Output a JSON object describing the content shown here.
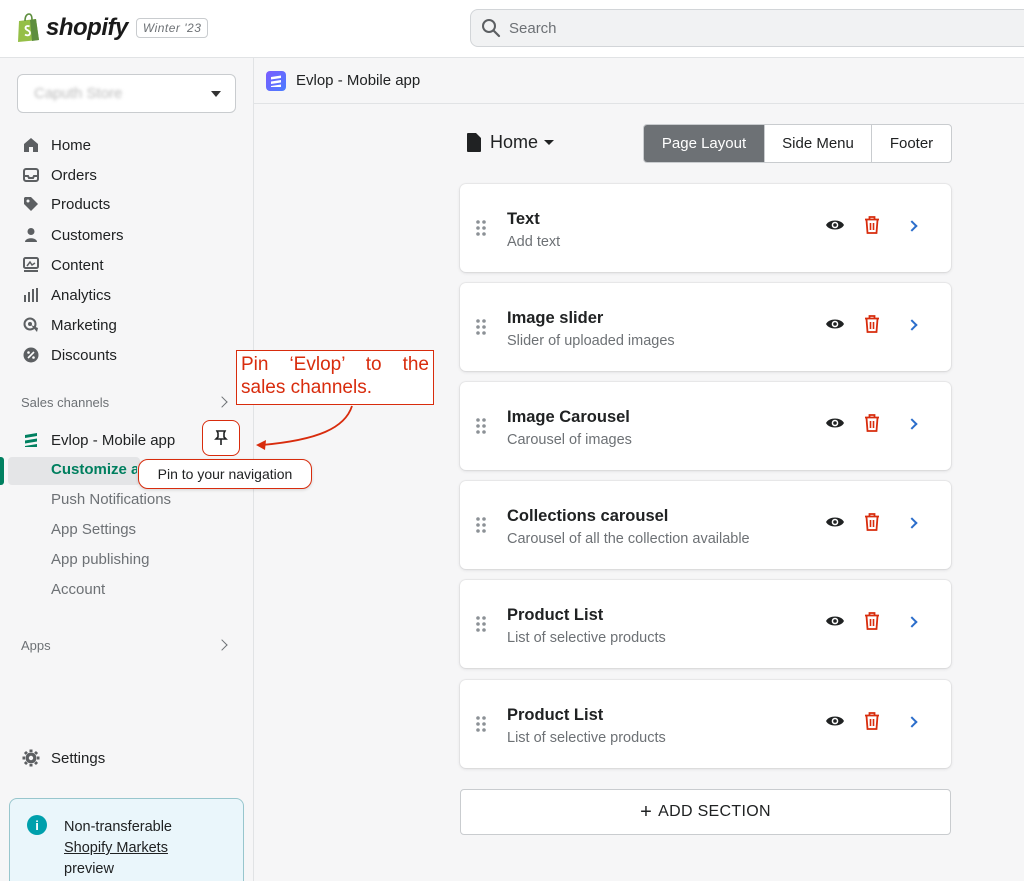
{
  "topbar": {
    "brand": "shopify",
    "version": "Winter '23",
    "search_placeholder": "Search"
  },
  "sidebar": {
    "store_name": "Caputh Store",
    "nav": [
      {
        "label": "Home",
        "icon": "home-icon"
      },
      {
        "label": "Orders",
        "icon": "orders-icon"
      },
      {
        "label": "Products",
        "icon": "tag-icon"
      },
      {
        "label": "Customers",
        "icon": "person-icon"
      },
      {
        "label": "Content",
        "icon": "content-icon"
      },
      {
        "label": "Analytics",
        "icon": "bar-chart-icon"
      },
      {
        "label": "Marketing",
        "icon": "target-icon"
      },
      {
        "label": "Discounts",
        "icon": "discount-icon"
      }
    ],
    "sales_channels_label": "Sales channels",
    "app_name": "Evlop - Mobile app",
    "sub_items": [
      "Customize app",
      "Push Notifications",
      "App Settings",
      "App publishing",
      "Account"
    ],
    "apps_label": "Apps",
    "settings_label": "Settings",
    "tooltip": "Pin to your navigation",
    "info": {
      "line1": "Non-transferable",
      "link": "Shopify Markets",
      "line3": "preview"
    }
  },
  "annotation": "Pin ‘Evlop’ to the sales channels.",
  "breadcrumb": "Evlop - Mobile app",
  "page_select": "Home",
  "tabs": [
    "Page Layout",
    "Side Menu",
    "Footer"
  ],
  "sections": [
    {
      "title": "Text",
      "subtitle": "Add text"
    },
    {
      "title": "Image slider",
      "subtitle": "Slider of uploaded images"
    },
    {
      "title": "Image Carousel",
      "subtitle": "Carousel of images"
    },
    {
      "title": "Collections carousel",
      "subtitle": "Carousel of all the collection available"
    },
    {
      "title": "Product List",
      "subtitle": "List of selective products"
    },
    {
      "title": "Product List",
      "subtitle": "List of selective products"
    }
  ],
  "add_section_label": "ADD SECTION",
  "colors": {
    "accent": "#008060",
    "danger": "#d82c0d",
    "link": "#2c6ecb",
    "tab_active": "#6d7175"
  }
}
